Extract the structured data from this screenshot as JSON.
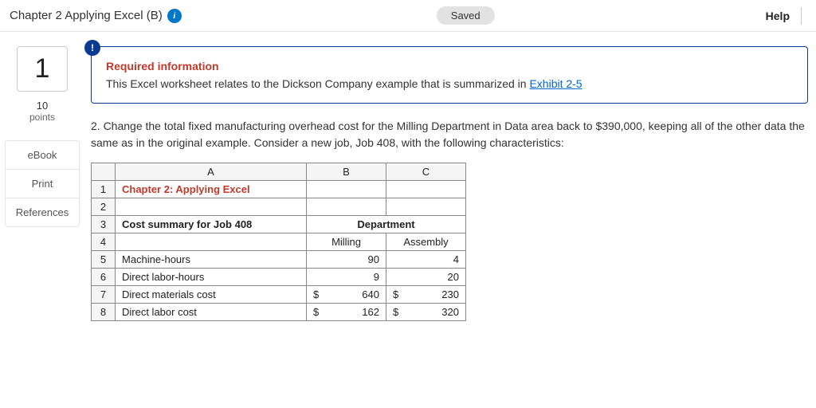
{
  "header": {
    "title": "Chapter 2 Applying Excel (B)",
    "info_icon": "i",
    "saved_label": "Saved",
    "help_label": "Help"
  },
  "sidebar": {
    "question_number": "1",
    "points_value": "10",
    "points_label": "points",
    "links": [
      "eBook",
      "Print",
      "References"
    ]
  },
  "alert": {
    "badge": "!",
    "title": "Required information",
    "text_prefix": "This Excel worksheet relates to the Dickson Company example that is summarized in ",
    "link_text": "Exhibit 2-5"
  },
  "question": {
    "text": "2. Change the total fixed manufacturing overhead cost for the Milling Department in Data area back to $390,000, keeping all of the other data the same as in the original example. Consider a new job, Job 408, with the following characteristics:"
  },
  "table": {
    "col_headers": [
      "",
      "A",
      "B",
      "C"
    ],
    "rows": {
      "r1_a": "Chapter 2: Applying Excel",
      "r3_a": "Cost summary for Job 408",
      "r3_bc": "Department",
      "r4_b": "Milling",
      "r4_c": "Assembly",
      "r5_a": "Machine-hours",
      "r5_b": "90",
      "r5_c": "4",
      "r6_a": "Direct labor-hours",
      "r6_b": "9",
      "r6_c": "20",
      "r7_a": "Direct materials cost",
      "r7_b_sym": "$",
      "r7_b_val": "640",
      "r7_c_sym": "$",
      "r7_c_val": "230",
      "r8_a": "Direct labor cost",
      "r8_b_sym": "$",
      "r8_b_val": "162",
      "r8_c_sym": "$",
      "r8_c_val": "320"
    }
  }
}
